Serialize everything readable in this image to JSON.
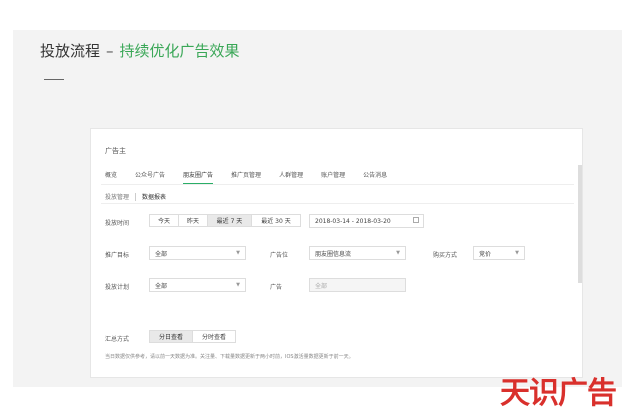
{
  "header": {
    "title": "投放流程",
    "dash": "–",
    "subtitle": "持续优化广告效果"
  },
  "card": {
    "title": "广告主",
    "tabs": [
      "概览",
      "公众号广告",
      "朋友圈广告",
      "推广页管理",
      "人群管理",
      "账户管理",
      "公告消息"
    ],
    "active_tab": "朋友圈广告",
    "subtabs": [
      "投放管理",
      "数据报表"
    ],
    "active_subtab": "数据报表"
  },
  "filters": {
    "time_label": "投放时间",
    "time_buttons": [
      "今天",
      "昨天",
      "最近 7 天",
      "最近 30 天"
    ],
    "time_selected": "最近 7 天",
    "date_range": "2018-03-14 - 2018-03-20",
    "target_label": "推广目标",
    "target_value": "全部",
    "position_label": "广告位",
    "position_value": "朋友圈信息流",
    "buy_label": "购买方式",
    "buy_value": "竞价",
    "plan_label": "投放计划",
    "plan_value": "全部",
    "ad_label": "广告",
    "ad_value": "全部",
    "summary_label": "汇总方式",
    "summary_buttons": [
      "分日查看",
      "分时查看"
    ],
    "summary_selected": "分日查看"
  },
  "note": "当日数据仅供参考，请以前一天数据为准。关注量、下载量数据更新于两小时前，IOS激活量数据更新于前一天。",
  "brand": "天识广告",
  "colors": {
    "accent": "#3aa757",
    "brand": "#d9302c"
  }
}
